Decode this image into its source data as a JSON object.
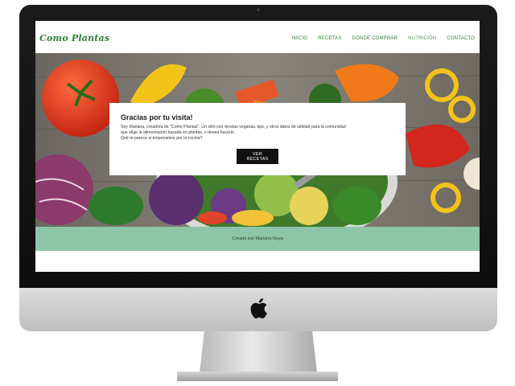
{
  "site": {
    "logo": "Como Plantas",
    "nav": [
      {
        "label": "INICIO"
      },
      {
        "label": "RECETAS"
      },
      {
        "label": "DÓNDE COMPRAR"
      },
      {
        "label": "NUTRICIÓN"
      },
      {
        "label": "CONTACTO"
      }
    ]
  },
  "hero": {
    "title": "Gracias por tu visita!",
    "text_line1": "Soy Mariana, creadora de \"Como Plantas\". Un sitio con recetas veganas, tips, y otros datos de utilidad para la comunidad",
    "text_line2": "que elige la alimentación basada en plantas, o desea hacerlo.",
    "text_line3": "Qué te parece si empezamos por la cocina?",
    "button_label": "VER RECETAS"
  },
  "footer": {
    "credit": "Creado por Mariana Noya"
  },
  "colors": {
    "brand_green": "#2e7d32",
    "footer_green": "#8dc5a8",
    "button_black": "#111111"
  },
  "device": {
    "logo_icon": "apple-icon"
  }
}
